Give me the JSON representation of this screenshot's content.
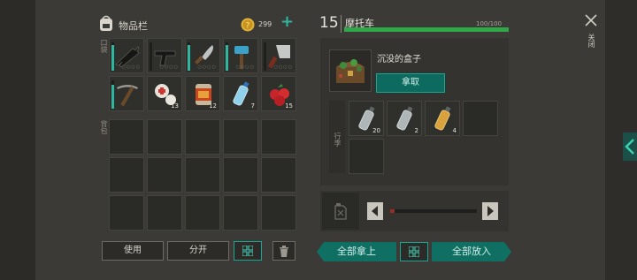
{
  "inventory": {
    "title": "物品栏",
    "coins": "299",
    "hotbar_label": "口袋",
    "backpack_label": "背包",
    "hotbar": [
      {
        "icon": "rifle-icon",
        "quantity": "",
        "durability": 0.9
      },
      {
        "icon": "pistol-icon",
        "quantity": "",
        "durability": 0.0
      },
      {
        "icon": "machete-icon",
        "quantity": "",
        "durability": 0.9
      },
      {
        "icon": "hammer-icon",
        "quantity": "",
        "durability": 0.9
      },
      {
        "icon": "cleaver-icon",
        "quantity": "",
        "durability": 0.0
      },
      {
        "icon": "pickaxe-icon",
        "quantity": "",
        "durability": 0.85
      },
      {
        "icon": "bandage-icon",
        "quantity": "13",
        "durability": null
      },
      {
        "icon": "canned-food-icon",
        "quantity": "12",
        "durability": null
      },
      {
        "icon": "water-bottle-icon",
        "quantity": "7",
        "durability": null
      },
      {
        "icon": "berries-icon",
        "quantity": "15",
        "durability": null
      }
    ],
    "buttons": {
      "use": "使用",
      "split": "分开"
    }
  },
  "vehicle": {
    "level": "15",
    "name": "摩托车",
    "hp": "100/100",
    "hp_fraction": 1.0,
    "found_item": "沉没的盒子",
    "take_button": "拿取",
    "storage_label": "行李",
    "storage": [
      {
        "icon": "water-bottle-icon",
        "quantity": "20"
      },
      {
        "icon": "water-bottle-icon",
        "quantity": "2"
      },
      {
        "icon": "fuel-bottle-icon",
        "quantity": "4"
      }
    ],
    "fuel_level": 0.05
  },
  "actions": {
    "take_all": "全部拿上",
    "put_all": "全部放入"
  },
  "sidebar": {
    "close_label": "关闭"
  },
  "colors": {
    "accent": "#1aa694",
    "hp_bar": "#2fa84a",
    "panel_bg": "#3b3a36"
  }
}
